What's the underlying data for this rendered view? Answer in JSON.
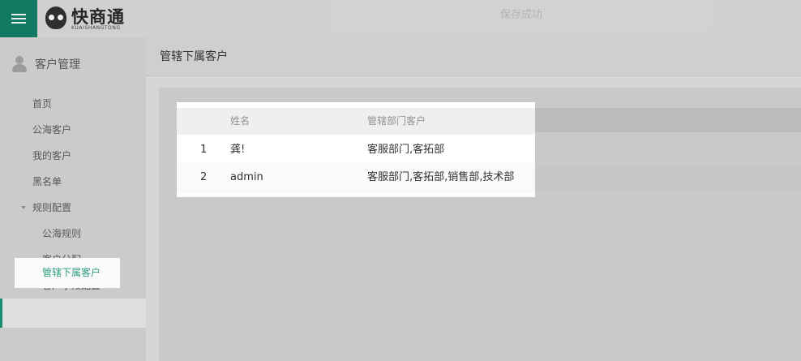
{
  "app": {
    "logo_text": "快商通",
    "logo_sub": "KUAISHANGTONG",
    "toast": "保存成功"
  },
  "sidebar": {
    "title": "客户管理",
    "items": [
      {
        "label": "首页"
      },
      {
        "label": "公海客户"
      },
      {
        "label": "我的客户"
      },
      {
        "label": "黑名单"
      },
      {
        "label": "规则配置"
      },
      {
        "label": "公海规则"
      },
      {
        "label": "客户分配"
      },
      {
        "label": "客户字段配置"
      },
      {
        "label": "管辖下属客户"
      }
    ]
  },
  "page": {
    "title": "管辖下属客户"
  },
  "table": {
    "headers": [
      "姓名",
      "管辖部门客户"
    ],
    "rows": [
      {
        "index": "1",
        "name": "龚!",
        "departments": "客服部门,客拓部"
      },
      {
        "index": "2",
        "name": "admin",
        "departments": "客服部门,客拓部,销售部,技术部"
      }
    ]
  },
  "colors": {
    "accent": "#1d8b71",
    "active_text": "#2e9d82"
  }
}
